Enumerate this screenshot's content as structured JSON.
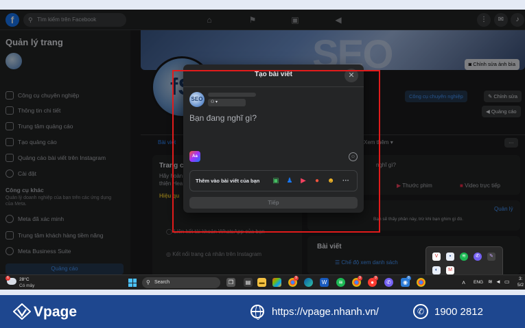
{
  "topnav": {
    "search_placeholder": "Tìm kiếm trên Facebook"
  },
  "sidebar": {
    "title": "Quản lý trang",
    "items": [
      {
        "label": "Công cụ chuyên nghiệp",
        "icon": "briefcase-icon"
      },
      {
        "label": "Thông tin chi tiết",
        "icon": "chart-icon"
      },
      {
        "label": "Trung tâm quảng cáo",
        "icon": "megaphone-icon"
      },
      {
        "label": "Tạo quảng cáo",
        "icon": "edit-icon"
      },
      {
        "label": "Quảng cáo bài viết trên Instagram",
        "icon": "instagram-icon"
      },
      {
        "label": "Cài đặt",
        "icon": "gear-icon"
      }
    ],
    "section_title": "Công cụ khác",
    "section_sub": "Quản lý doanh nghiệp của bạn trên các ứng dụng của Meta.",
    "tools": [
      {
        "label": "Meta đã xác minh",
        "icon": "verified-icon"
      },
      {
        "label": "Trung tâm khách hàng tiềm năng",
        "icon": "users-icon"
      },
      {
        "label": "Meta Business Suite",
        "icon": "meta-icon"
      }
    ],
    "ads_button": "Quảng cáo"
  },
  "page": {
    "edit_cover": "Chỉnh sửa ảnh bìa",
    "pro_tools": "Công cụ chuyên nghiệp",
    "edit": "Chỉnh sửa",
    "ads": "Quảng cáo",
    "tab_posts": "Bài viết",
    "tab_more": "Xem thêm",
    "left_title": "Trang c",
    "left_line1": "Hãy hoàn",
    "left_line2": "thiện Hea",
    "left_progress": "Hiệu qu",
    "composer_hint": "nghĩ gì?",
    "video_photo": "Thước phim",
    "live": "Video trực tiếp",
    "whatsapp": "Liên kết tài khoản WhatsApp của bạn",
    "instagram": "Kết nối trang cá nhân trên Instagram",
    "feed_note": "Bạn sẽ thấy phân này, trừ khi bạn ghim gì đó.",
    "manage": "Quản lý",
    "posts_heading": "Bài viết",
    "list_view": "Chế độ xem danh sách"
  },
  "modal": {
    "title": "Tạo bài viết",
    "placeholder": "Bạn đang nghĩ gì?",
    "add_to_post": "Thêm vào bài viết của bạn",
    "next_button": "Tiếp",
    "aa_label": "Aa",
    "add_icons": [
      "photo-icon",
      "tag-people-icon",
      "video-icon",
      "location-icon",
      "feeling-icon",
      "more-icon"
    ]
  },
  "taskbar": {
    "temperature": "28°C",
    "weather": "Có mây",
    "search": "Search",
    "lang": "ENG",
    "time": "3:",
    "date": "5/2"
  },
  "footer": {
    "brand": "Vpage",
    "url": "https://vpage.nhanh.vn/",
    "phone": "1900 2812"
  },
  "colors": {
    "highlight": "#e21b1b",
    "footer_bg": "#1e478f",
    "fb_blue": "#1877f2"
  }
}
